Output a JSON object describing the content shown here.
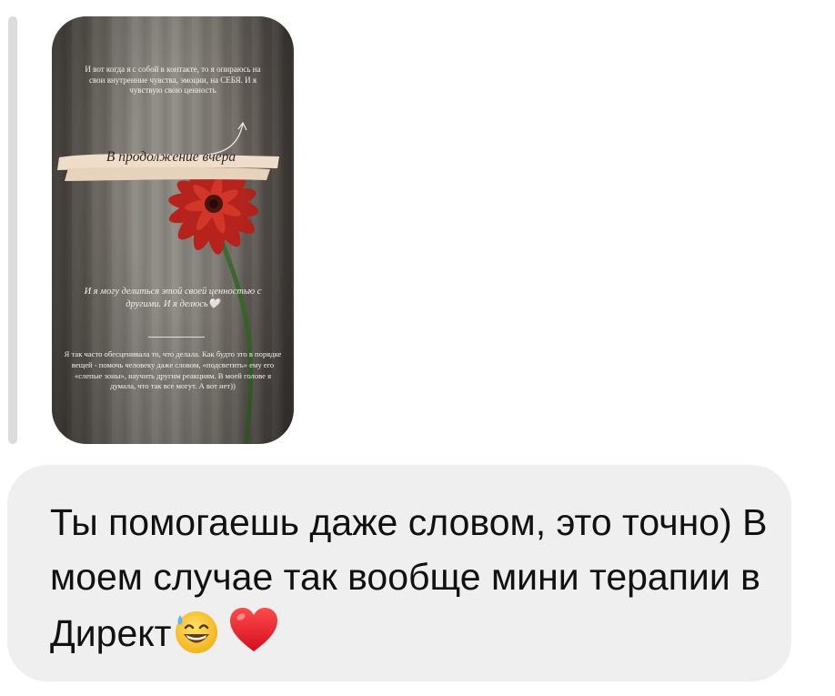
{
  "story": {
    "text_intro": "И вот когда я с собой в контакте, то я опираюсь на свои внутренние чувства, эмоции, на СЕБЯ. И я чувствую свою ценность",
    "banner_label": "В продолжение вчера",
    "text_share": "И я могу делиться этой своей ценностью с другими. И я делюсь",
    "share_emoji": "🤍",
    "text_body": "Я так часто обесценивала то, что делала. Как будто это в порядке вещей - помочь человеку даже словом, «подсветить» ему его «слепые зоны», научить другим реакциям. В моей голове я думала, что так все могут. А вот нет))"
  },
  "message": {
    "text": "Ты помогаешь даже словом, это точно) В моем случае так вообще мини терапии в Директ",
    "emoji_1": "sweat-smile-emoji",
    "emoji_2": "red-heart-emoji"
  }
}
